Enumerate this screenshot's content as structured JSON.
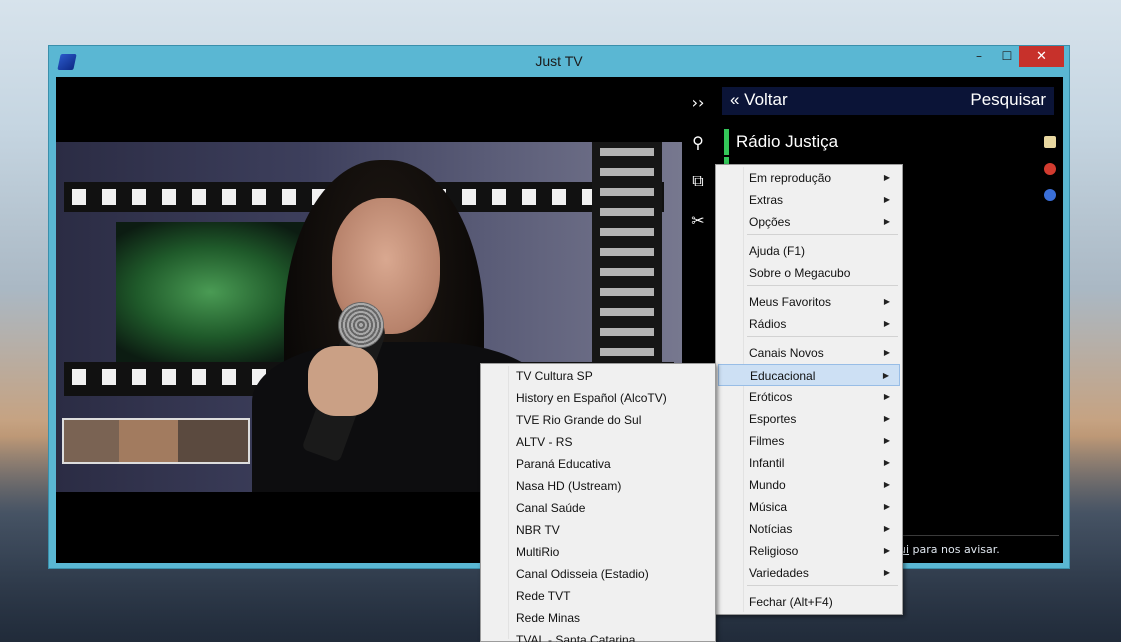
{
  "window": {
    "title": "Just TV",
    "minimize": "–",
    "maximize": "☐",
    "close": "✕"
  },
  "sidebar_controls": {
    "expand": "››",
    "search": "⚲",
    "pip": "⧉",
    "tools": "✂"
  },
  "header": {
    "back_label": "« Voltar",
    "search_label": "Pesquisar"
  },
  "channel": {
    "name": "Rádio Justiça",
    "accent_color": "#34c759"
  },
  "status": {
    "prefix": "ui",
    "suffix": " para nos avisar."
  },
  "main_menu": {
    "items": [
      {
        "label": "Em reprodução",
        "submenu": true
      },
      {
        "label": "Extras",
        "submenu": true
      },
      {
        "label": "Opções",
        "submenu": true
      },
      {
        "label": "Ajuda (F1)",
        "submenu": false
      },
      {
        "label": "Sobre o Megacubo",
        "submenu": false
      },
      {
        "label": "Meus Favoritos",
        "submenu": true
      },
      {
        "label": "Rádios",
        "submenu": true
      },
      {
        "label": "Canais Novos",
        "submenu": true
      },
      {
        "label": "Educacional",
        "submenu": true,
        "highlighted": true
      },
      {
        "label": "Eróticos",
        "submenu": true
      },
      {
        "label": "Esportes",
        "submenu": true
      },
      {
        "label": "Filmes",
        "submenu": true
      },
      {
        "label": "Infantil",
        "submenu": true
      },
      {
        "label": "Mundo",
        "submenu": true
      },
      {
        "label": "Música",
        "submenu": true
      },
      {
        "label": "Notícias",
        "submenu": true
      },
      {
        "label": "Religioso",
        "submenu": true
      },
      {
        "label": "Variedades",
        "submenu": true
      },
      {
        "label": "Fechar (Alt+F4)",
        "submenu": false
      }
    ],
    "arrow": "▶"
  },
  "sub_menu": {
    "items": [
      "TV Cultura SP",
      "History en Español (AlcoTV)",
      "TVE Rio Grande do Sul",
      "ALTV - RS",
      "Paraná Educativa",
      "Nasa HD (Ustream)",
      "Canal Saúde",
      "NBR TV",
      "MultiRio",
      "Canal Odisseia (Estadio)",
      "Rede TVT",
      "Rede Minas",
      "TVAL - Santa Catarina"
    ]
  }
}
